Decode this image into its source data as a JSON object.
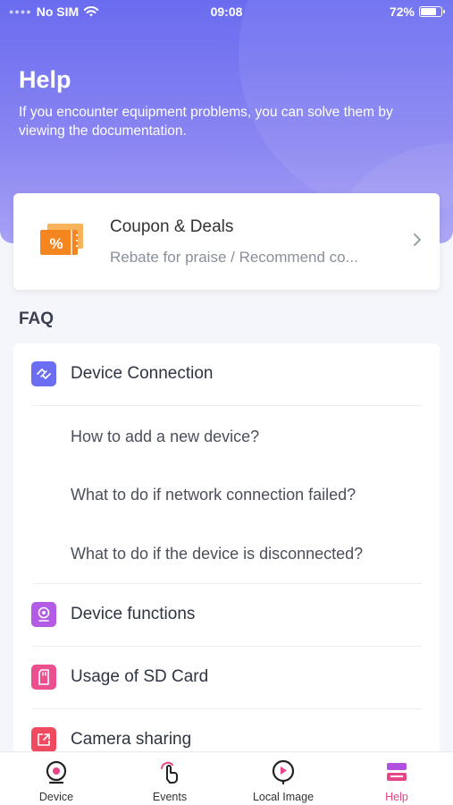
{
  "status_bar": {
    "carrier": "No SIM",
    "time": "09:08",
    "battery": "72%",
    "battery_level": 0.72
  },
  "hero": {
    "title": "Help",
    "subtitle": "If you encounter equipment problems, you can solve them by viewing the documentation."
  },
  "coupon": {
    "title": "Coupon & Deals",
    "subtitle": "Rebate for praise / Recommend co...",
    "icon": "coupon-ticket-icon",
    "icon_text": "%"
  },
  "faq": {
    "title": "FAQ",
    "sections": [
      {
        "label": "Device Connection",
        "icon": "device-connection-icon",
        "color": "#6b6ef2",
        "items": [
          "How to add a new device?",
          "What to do if network connection failed?",
          "What to do if the device is disconnected?"
        ]
      },
      {
        "label": "Device functions",
        "icon": "camera-icon",
        "color": "#b45be6"
      },
      {
        "label": "Usage of SD Card",
        "icon": "sd-card-icon",
        "color": "#ec4f8e"
      },
      {
        "label": "Camera sharing",
        "icon": "share-icon",
        "color": "#ef4a60"
      }
    ]
  },
  "tabs": [
    {
      "label": "Device",
      "icon": "device-icon"
    },
    {
      "label": "Events",
      "icon": "touch-icon"
    },
    {
      "label": "Local Image",
      "icon": "local-image-icon"
    },
    {
      "label": "Help",
      "icon": "help-icon",
      "active": true
    }
  ],
  "colors": {
    "accent": "#e8448a",
    "hero_top": "#6a6cf0",
    "coupon_orange": "#f5861f"
  }
}
